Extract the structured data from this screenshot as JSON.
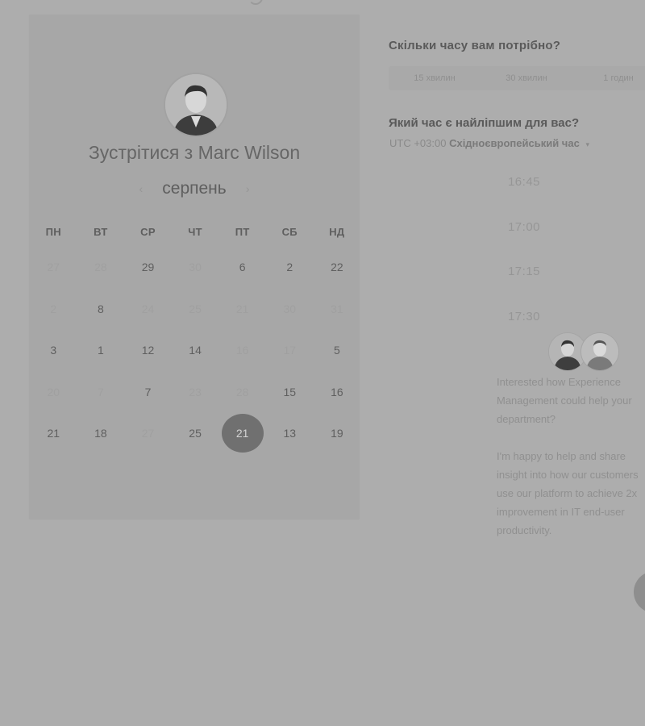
{
  "calendar": {
    "title": "Зустрітися з Marc Wilson",
    "month": "серпень",
    "prev_icon": "chevron-left-icon",
    "next_icon": "chevron-right-icon",
    "weekdays": [
      "ПН",
      "ВТ",
      "СР",
      "ЧТ",
      "ПТ",
      "СБ",
      "НД"
    ],
    "weeks": [
      [
        {
          "d": "27",
          "dim": true
        },
        {
          "d": "28",
          "dim": true
        },
        {
          "d": "29",
          "dim": false
        },
        {
          "d": "30",
          "dim": true
        },
        {
          "d": "6",
          "dim": false
        },
        {
          "d": "2",
          "dim": false
        },
        {
          "d": "22",
          "dim": false
        }
      ],
      [
        {
          "d": "2",
          "dim": true
        },
        {
          "d": "8",
          "dim": false
        },
        {
          "d": "24",
          "dim": true
        },
        {
          "d": "25",
          "dim": true
        },
        {
          "d": "21",
          "dim": true
        },
        {
          "d": "30",
          "dim": true
        },
        {
          "d": "31",
          "dim": true
        }
      ],
      [
        {
          "d": "3",
          "dim": false
        },
        {
          "d": "1",
          "dim": false
        },
        {
          "d": "12",
          "dim": false
        },
        {
          "d": "14",
          "dim": false
        },
        {
          "d": "16",
          "dim": true
        },
        {
          "d": "17",
          "dim": true
        },
        {
          "d": "5",
          "dim": false
        }
      ],
      [
        {
          "d": "20",
          "dim": true
        },
        {
          "d": "7",
          "dim": true
        },
        {
          "d": "7",
          "dim": false
        },
        {
          "d": "23",
          "dim": true
        },
        {
          "d": "28",
          "dim": true
        },
        {
          "d": "15",
          "dim": false
        },
        {
          "d": "16",
          "dim": false
        }
      ],
      [
        {
          "d": "21",
          "dim": false
        },
        {
          "d": "18",
          "dim": false
        },
        {
          "d": "27",
          "dim": true
        },
        {
          "d": "25",
          "dim": false
        },
        {
          "d": "21",
          "dim": false,
          "selected": true
        },
        {
          "d": "13",
          "dim": false
        },
        {
          "d": "19",
          "dim": false
        }
      ]
    ]
  },
  "duration": {
    "question": "Скільки часу вам потрібно?",
    "options": [
      "15 хвилин",
      "30 хвилин",
      "1 годин"
    ]
  },
  "time": {
    "question": "Який час є найліпшим для вас?",
    "timezone_offset": "UTC +03:00",
    "timezone_name": "Східноєвропейський час",
    "slots": [
      "16:45",
      "17:00",
      "17:15",
      "17:30"
    ]
  },
  "description": "Interested how Experience Management could help your department?\n\nI'm happy to help and share insight into how our customers use our platform to achieve 2x improvement in IT end-user productivity."
}
